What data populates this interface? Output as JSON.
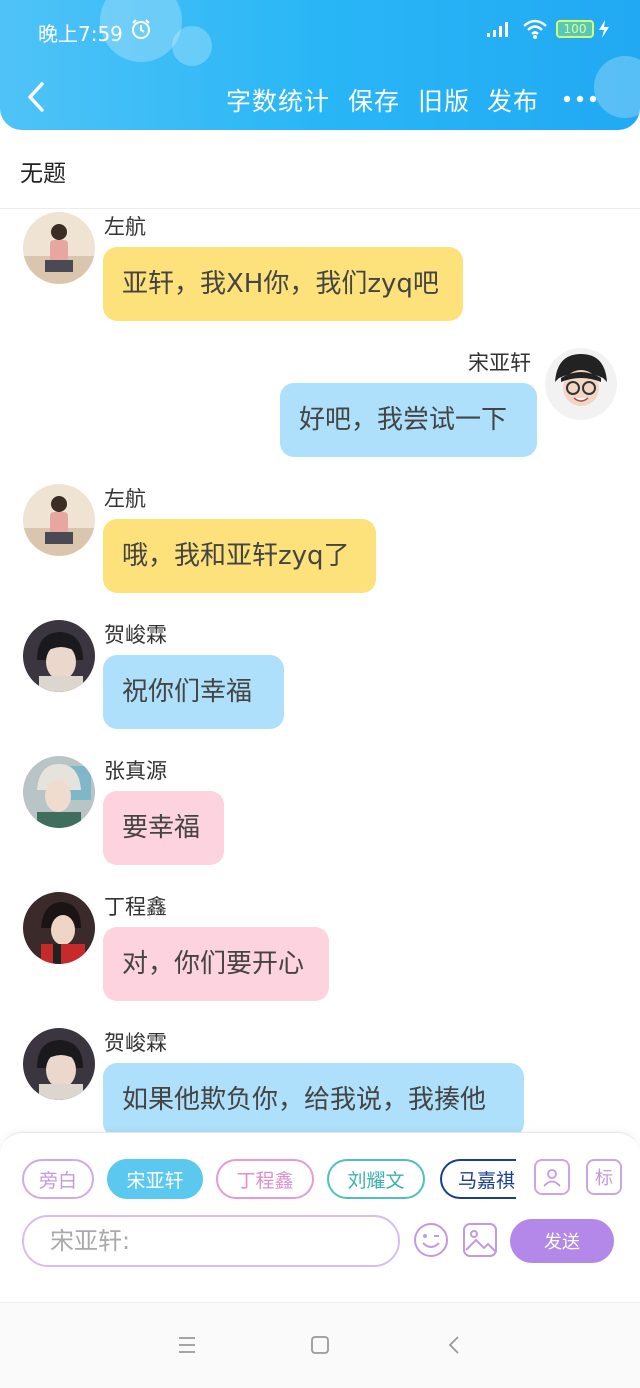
{
  "status_bar": {
    "time": "晚上7:59",
    "battery": "100"
  },
  "toolbar": {
    "word_count": "字数统计",
    "save": "保存",
    "old_version": "旧版",
    "publish": "发布"
  },
  "story": {
    "title": "无题"
  },
  "messages": [
    {
      "speaker": "左航",
      "text": "亚轩，我XH你，我们zyq吧",
      "side": "left",
      "color": "#fde17a"
    },
    {
      "speaker": "宋亚轩",
      "text": "好吧，我尝试一下",
      "side": "right",
      "color": "#aee0fb"
    },
    {
      "speaker": "左航",
      "text": "哦，我和亚轩zyq了",
      "side": "left",
      "color": "#fde17a"
    },
    {
      "speaker": "贺峻霖",
      "text": "祝你们幸福",
      "side": "left",
      "color": "#aee0fb"
    },
    {
      "speaker": "张真源",
      "text": "要幸福",
      "side": "left",
      "color": "#fcd3de"
    },
    {
      "speaker": "丁程鑫",
      "text": "对，你们要开心",
      "side": "left",
      "color": "#fcd3de"
    },
    {
      "speaker": "贺峻霖",
      "text": "如果他欺负你，给我说，我揍他",
      "side": "left",
      "color": "#aee0fb"
    }
  ],
  "composer": {
    "roles": [
      {
        "label": "旁白",
        "color": "#d3a8e6"
      },
      {
        "label": "宋亚轩",
        "color": "#5bc8ef",
        "selected": true
      },
      {
        "label": "丁程鑫",
        "color": "#e79bd3"
      },
      {
        "label": "刘耀文",
        "color": "#4fc0c0"
      },
      {
        "label": "马嘉祺",
        "color": "#1a3f8f"
      }
    ],
    "tag_button": "标",
    "input_placeholder": "宋亚轩:",
    "send": "发送"
  }
}
